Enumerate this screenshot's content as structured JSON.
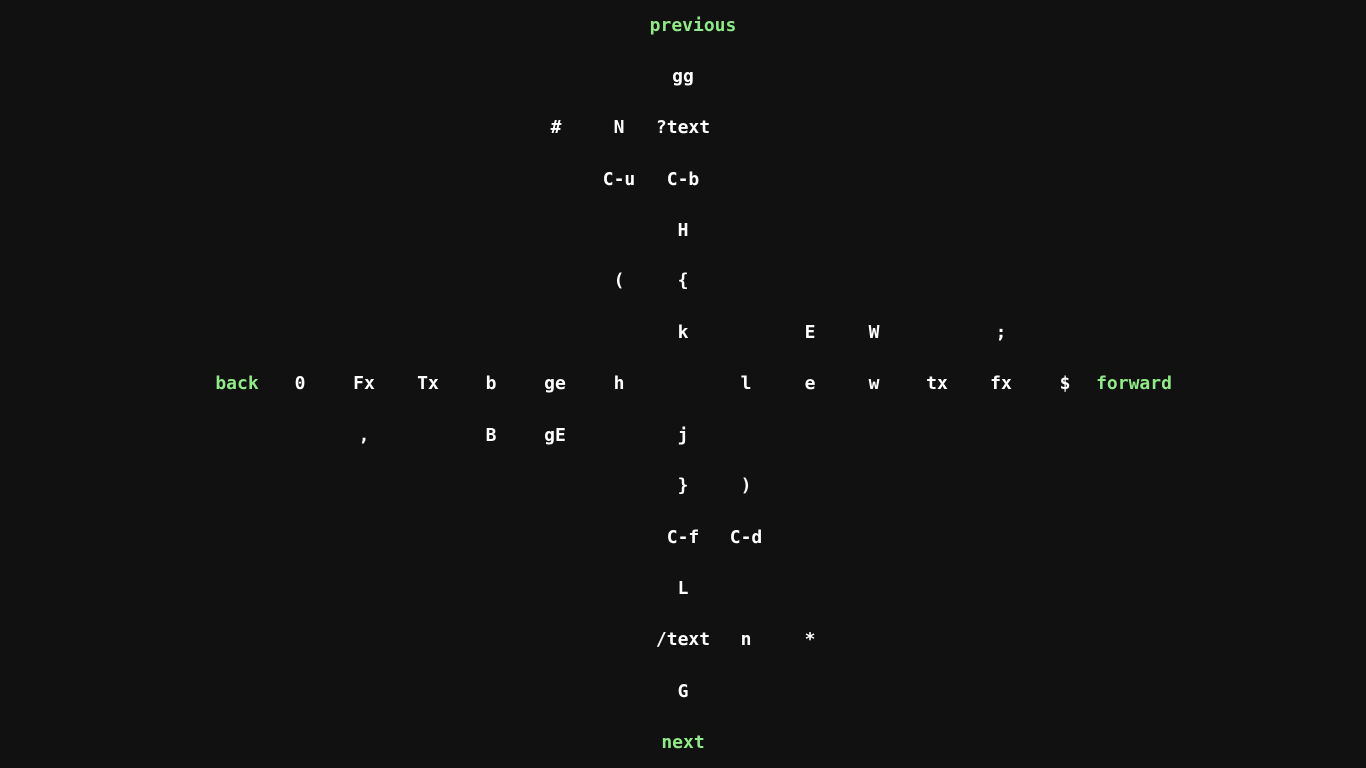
{
  "colors": {
    "background": "#111111",
    "key": "#ffffff",
    "direction": "#8fea87"
  },
  "directions": {
    "previous": "previous",
    "next": "next",
    "back": "back",
    "forward": "forward"
  },
  "up": {
    "row1": [
      "gg"
    ],
    "row2": [
      "#",
      "N",
      "?text"
    ],
    "row3": [
      "C-u",
      "C-b"
    ],
    "row4": [
      "H"
    ],
    "row5": [
      "(",
      "{"
    ],
    "row6": [
      "k",
      "E",
      "W",
      ";"
    ]
  },
  "left": [
    "0",
    "Fx",
    "Tx",
    "b",
    "ge",
    "h"
  ],
  "right": [
    "l",
    "e",
    "w",
    "tx",
    "fx",
    "$"
  ],
  "down": {
    "row1": [
      ",",
      "B",
      "gE",
      "j"
    ],
    "row2": [
      "}",
      ")"
    ],
    "row3": [
      "C-f",
      "C-d"
    ],
    "row4": [
      "L"
    ],
    "row5": [
      "/text",
      "n",
      "*"
    ],
    "row6": [
      "G"
    ]
  }
}
